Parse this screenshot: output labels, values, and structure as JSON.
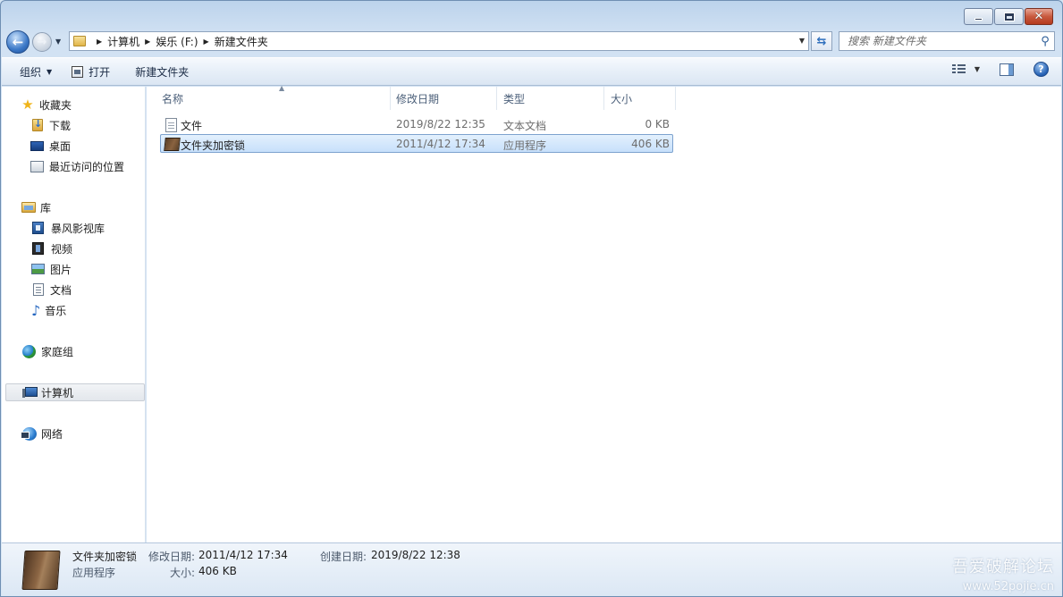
{
  "address": {
    "crumbs": [
      "计算机",
      "娱乐 (F:)",
      "新建文件夹"
    ]
  },
  "search": {
    "placeholder": "搜索 新建文件夹"
  },
  "toolbar": {
    "organize": "组织",
    "open": "打开",
    "new_folder": "新建文件夹"
  },
  "nav": {
    "favorites": "收藏夹",
    "downloads": "下载",
    "desktop": "桌面",
    "recent": "最近访问的位置",
    "libraries": "库",
    "baofeng": "暴风影视库",
    "videos": "视频",
    "pictures": "图片",
    "documents": "文档",
    "music": "音乐",
    "homegroup": "家庭组",
    "computer": "计算机",
    "network": "网络"
  },
  "columns": {
    "name": "名称",
    "modified": "修改日期",
    "type": "类型",
    "size": "大小"
  },
  "files": [
    {
      "name": "文件",
      "modified": "2019/8/22 12:35",
      "type": "文本文档",
      "size": "0 KB"
    },
    {
      "name": "文件夹加密锁",
      "modified": "2011/4/12 17:34",
      "type": "应用程序",
      "size": "406 KB"
    }
  ],
  "details": {
    "name": "文件夹加密锁",
    "type": "应用程序",
    "modified_label": "修改日期:",
    "modified_value": "2011/4/12 17:34",
    "size_label": "大小:",
    "size_value": "406 KB",
    "created_label": "创建日期:",
    "created_value": "2019/8/22 12:38"
  },
  "watermark": {
    "line1": "吾爱破解论坛",
    "line2": "www.52pojie.cn"
  }
}
